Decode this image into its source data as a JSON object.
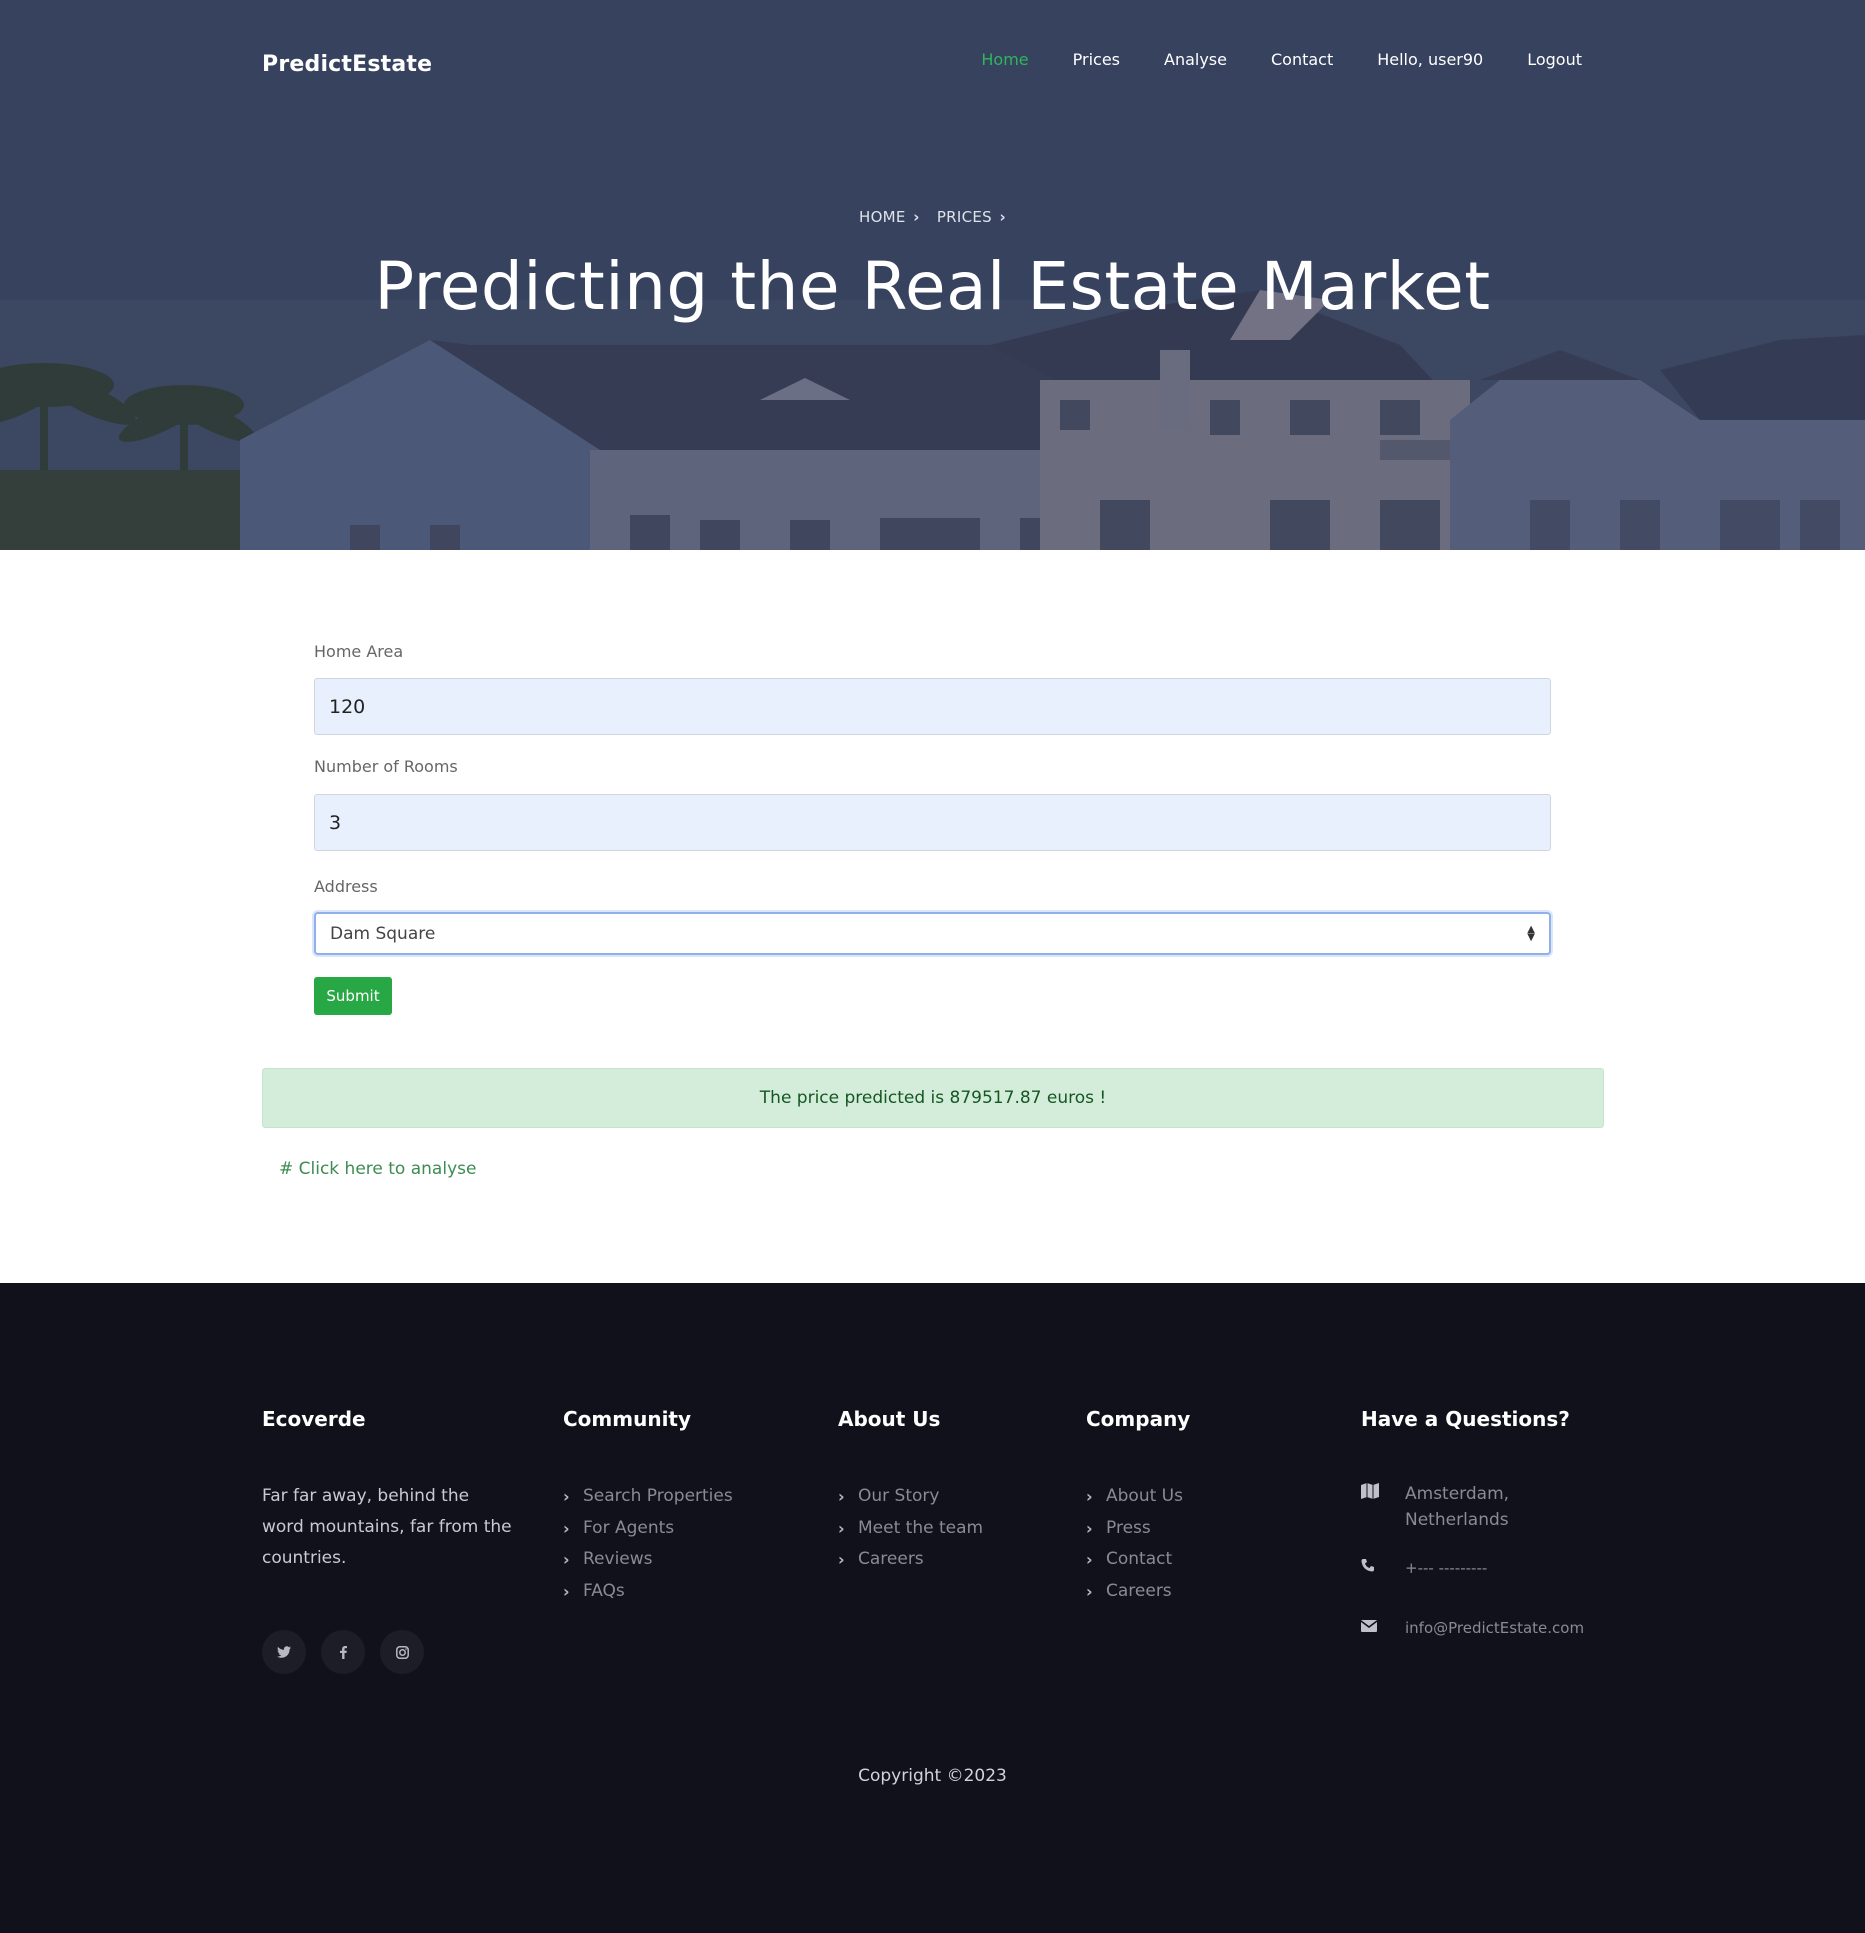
{
  "nav": {
    "brand": "PredictEstate",
    "links": [
      "Home",
      "Prices",
      "Analyse",
      "Contact",
      "Hello, user90",
      "Logout"
    ],
    "active_color": "#2fb55d"
  },
  "hero": {
    "breadcrumb": [
      "HOME",
      "PRICES"
    ],
    "title": "Predicting the Real Estate Market"
  },
  "form": {
    "home_area_label": "Home Area",
    "home_area_value": "120",
    "rooms_label": "Number of Rooms",
    "rooms_value": "3",
    "address_label": "Address",
    "address_value": "Dam Square",
    "submit_label": "Submit",
    "submit_color": "#28a745"
  },
  "result": {
    "message": "The price predicted is 879517.87 euros !",
    "analyse_link": "# Click here to analyse"
  },
  "footer": {
    "about": {
      "title": "Ecoverde",
      "text": "Far far away, behind the word mountains, far from the countries.",
      "socials": [
        "twitter-icon",
        "facebook-icon",
        "instagram-icon"
      ]
    },
    "community": {
      "title": "Community",
      "items": [
        "Search Properties",
        "For Agents",
        "Reviews",
        "FAQs"
      ]
    },
    "about_us": {
      "title": "About Us",
      "items": [
        "Our Story",
        "Meet the team",
        "Careers"
      ]
    },
    "company": {
      "title": "Company",
      "items": [
        "About Us",
        "Press",
        "Contact",
        "Careers"
      ]
    },
    "questions": {
      "title": "Have a Questions?",
      "address": "Amsterdam, Netherlands",
      "phone": "+--- ---------",
      "email": "info@PredictEstate.com"
    },
    "copyright": "Copyright ©2023"
  }
}
